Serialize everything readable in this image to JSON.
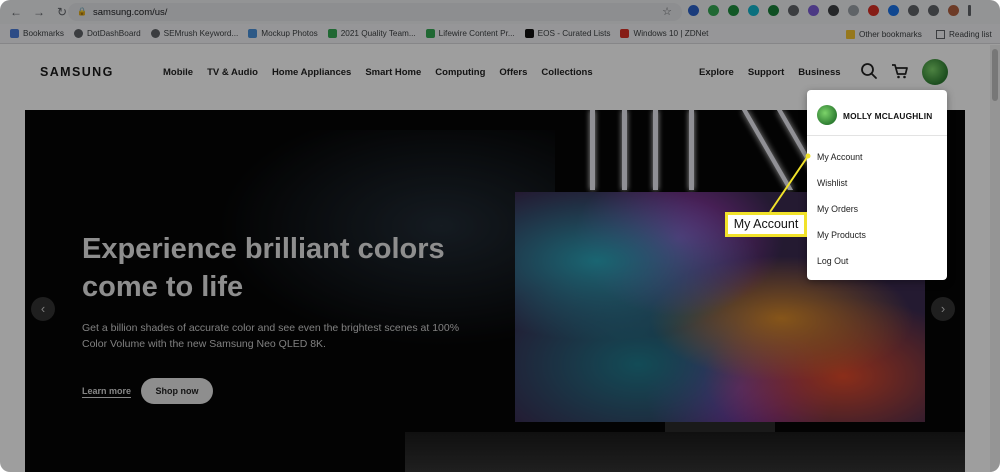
{
  "browser": {
    "url": "samsung.com/us/",
    "bookmarks": [
      {
        "label": "Bookmarks",
        "color": "#4a7bd9"
      },
      {
        "label": "DotDashBoard",
        "color": "#5f6368"
      },
      {
        "label": "SEMrush Keyword...",
        "color": "#5f6368"
      },
      {
        "label": "Mockup Photos",
        "color": "#4a90d9"
      },
      {
        "label": "2021 Quality Team...",
        "color": "#34a853"
      },
      {
        "label": "Lifewire Content Pr...",
        "color": "#34a853"
      },
      {
        "label": "EOS - Curated Lists",
        "color": "#111111"
      },
      {
        "label": "Windows 10 | ZDNet",
        "color": "#d93025"
      }
    ],
    "other_bookmarks": "Other bookmarks",
    "reading_list": "Reading list"
  },
  "header": {
    "logo": "SAMSUNG",
    "main_nav": [
      "Mobile",
      "TV & Audio",
      "Home Appliances",
      "Smart Home",
      "Computing",
      "Offers",
      "Collections"
    ],
    "util_nav": [
      "Explore",
      "Support",
      "Business"
    ]
  },
  "hero": {
    "title": "Experience brilliant colors come to life",
    "subtitle": "Get a billion shades of accurate color and see even the brightest scenes at 100% Color Volume with the new Samsung Neo QLED 8K.",
    "learn_more": "Learn more",
    "shop_now": "Shop now"
  },
  "account_menu": {
    "user_name": "MOLLY MCLAUGHLIN",
    "items": [
      "My Account",
      "Wishlist",
      "My Orders",
      "My Products",
      "Log Out"
    ]
  },
  "callout": {
    "label": "My Account",
    "color": "#f1e22a"
  }
}
